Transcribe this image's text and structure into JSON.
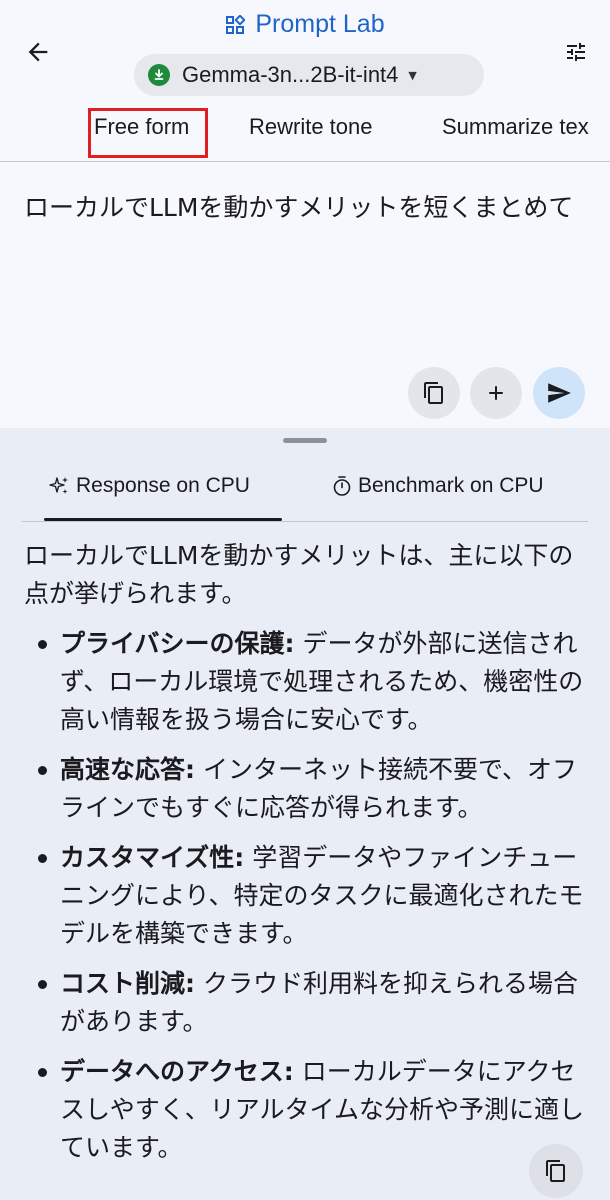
{
  "header": {
    "title": "Prompt Lab",
    "model_name": "Gemma-3n...2B-it-int4"
  },
  "template_tabs": [
    "Free form",
    "Rewrite tone",
    "Summarize tex"
  ],
  "selected_tab": "Free form",
  "prompt": {
    "text": "ローカルでLLMを動かすメリットを短くまとめて"
  },
  "result_tabs": {
    "response": "Response on CPU",
    "benchmark": "Benchmark on CPU"
  },
  "response": {
    "intro": "ローカルでLLMを動かすメリットは、主に以下の点が挙げられます。",
    "items": [
      {
        "title": "プライバシーの保護:",
        "text": " データが外部に送信されず、ローカル環境で処理されるため、機密性の高い情報を扱う場合に安心です。"
      },
      {
        "title": "高速な応答:",
        "text": " インターネット接続不要で、オフラインでもすぐに応答が得られます。"
      },
      {
        "title": "カスタマイズ性:",
        "text": " 学習データやファインチューニングにより、特定のタスクに最適化されたモデルを構築できます。"
      },
      {
        "title": "コスト削減:",
        "text": " クラウド利用料を抑えられる場合があります。"
      },
      {
        "title": "データへのアクセス:",
        "text": " ローカルデータにアクセスしやすく、リアルタイムな分析や予測に適しています。"
      }
    ]
  },
  "colors": {
    "accent": "#1f64c8",
    "send_button": "#cfe4f9",
    "highlight_box": "#e02020"
  }
}
